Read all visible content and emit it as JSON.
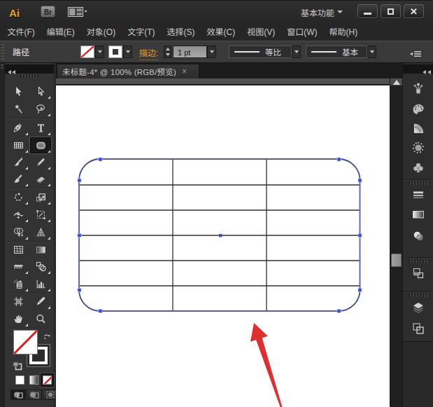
{
  "titlebar": {
    "app_logo": "Ai",
    "bridge_button": "Br",
    "workspace_switcher": "基本功能",
    "window_controls": {
      "minimize": "minimize",
      "maximize": "maximize",
      "close": "✕"
    }
  },
  "menubar": {
    "items": [
      "文件(F)",
      "编辑(E)",
      "对象(O)",
      "文字(T)",
      "选择(S)",
      "效果(C)",
      "视图(V)",
      "窗口(W)",
      "帮助(H)"
    ]
  },
  "controlbar": {
    "context_label": "路径",
    "stroke_label": "描边:",
    "stroke_weight_value": "1 pt",
    "variable_width_profile": "等比",
    "brush_definition": "基本"
  },
  "document_tab": {
    "title": "未标题-4* @ 100% (RGB/预览)",
    "close_glyph": "×"
  },
  "toolbar": {
    "tools": [
      {
        "name": "选择工具",
        "icon": "sel",
        "fly": false
      },
      {
        "name": "直接选择工具",
        "icon": "dsel",
        "fly": true
      },
      {
        "name": "魔棒工具",
        "icon": "wand",
        "fly": false
      },
      {
        "name": "套索工具",
        "icon": "lasso",
        "fly": true
      },
      {
        "name": "钢笔工具",
        "icon": "pen",
        "fly": true
      },
      {
        "name": "文字工具",
        "icon": "type",
        "fly": true
      },
      {
        "name": "矩形网格工具",
        "icon": "grid",
        "fly": true
      },
      {
        "name": "圆角矩形工具",
        "icon": "rrect",
        "fly": true,
        "selected": true
      },
      {
        "name": "画笔工具",
        "icon": "brush",
        "fly": true
      },
      {
        "name": "铅笔工具",
        "icon": "pencil",
        "fly": true
      },
      {
        "name": "斑点画笔工具",
        "icon": "blob",
        "fly": true
      },
      {
        "name": "橡皮擦工具",
        "icon": "eraser",
        "fly": true
      },
      {
        "name": "旋转工具",
        "icon": "rotate",
        "fly": true
      },
      {
        "name": "比例缩放工具",
        "icon": "scale",
        "fly": true
      },
      {
        "name": "宽度工具",
        "icon": "width",
        "fly": true
      },
      {
        "name": "自由变换工具",
        "icon": "ftrans",
        "fly": true
      },
      {
        "name": "形状生成器工具",
        "icon": "shapeb",
        "fly": true
      },
      {
        "name": "透视网格工具",
        "icon": "persp",
        "fly": true
      },
      {
        "name": "网格工具",
        "icon": "mesh",
        "fly": false
      },
      {
        "name": "渐变工具",
        "icon": "grad",
        "fly": false
      },
      {
        "name": "度量工具",
        "icon": "ruler",
        "fly": true
      },
      {
        "name": "混合工具",
        "icon": "blend",
        "fly": true
      },
      {
        "name": "符号喷枪工具",
        "icon": "spray",
        "fly": true
      },
      {
        "name": "柱形图工具",
        "icon": "chart",
        "fly": true
      },
      {
        "name": "画板工具",
        "icon": "artb",
        "fly": false
      },
      {
        "name": "切片工具",
        "icon": "slice",
        "fly": true
      },
      {
        "name": "抓手工具",
        "icon": "hand",
        "fly": true
      },
      {
        "name": "缩放工具",
        "icon": "zoom",
        "fly": false
      }
    ],
    "selected_tool": "圆角矩形工具",
    "fill_setting": "none",
    "stroke_setting": "color",
    "color_buttons": [
      "color",
      "gradient",
      "none"
    ],
    "active_color_button": "none",
    "drawing_modes": [
      "normal",
      "behind",
      "inside"
    ],
    "active_drawing_mode": "normal"
  },
  "right_dock": {
    "panel_icons": [
      {
        "icon": "plant"
      },
      {
        "icon": "palette"
      },
      {
        "icon": "fan"
      },
      {
        "icon": "ring"
      },
      {
        "icon": "club"
      },
      {
        "icon": "strokes"
      },
      {
        "icon": "gradsw"
      },
      {
        "icon": "transp"
      },
      {
        "icon": "styles"
      },
      {
        "icon": "layers"
      },
      {
        "icon": "artbs"
      }
    ]
  },
  "canvas": {
    "artboard_color": "#ffffff",
    "object": {
      "type": "rounded-rectangle-table",
      "columns": 3,
      "rows": 6,
      "selected": true,
      "selection_color": "#4f5fae",
      "grid_line_color": "#2c3036"
    },
    "annotation": {
      "type": "red-arrow",
      "color": "#e12f2f",
      "points_to": "table bottom edge"
    }
  },
  "colors": {
    "accent_orange": "#e39a35",
    "logo_orange": "#eda12e",
    "selection_blue": "#4f5fae",
    "arrow_red": "#e12f2f"
  }
}
